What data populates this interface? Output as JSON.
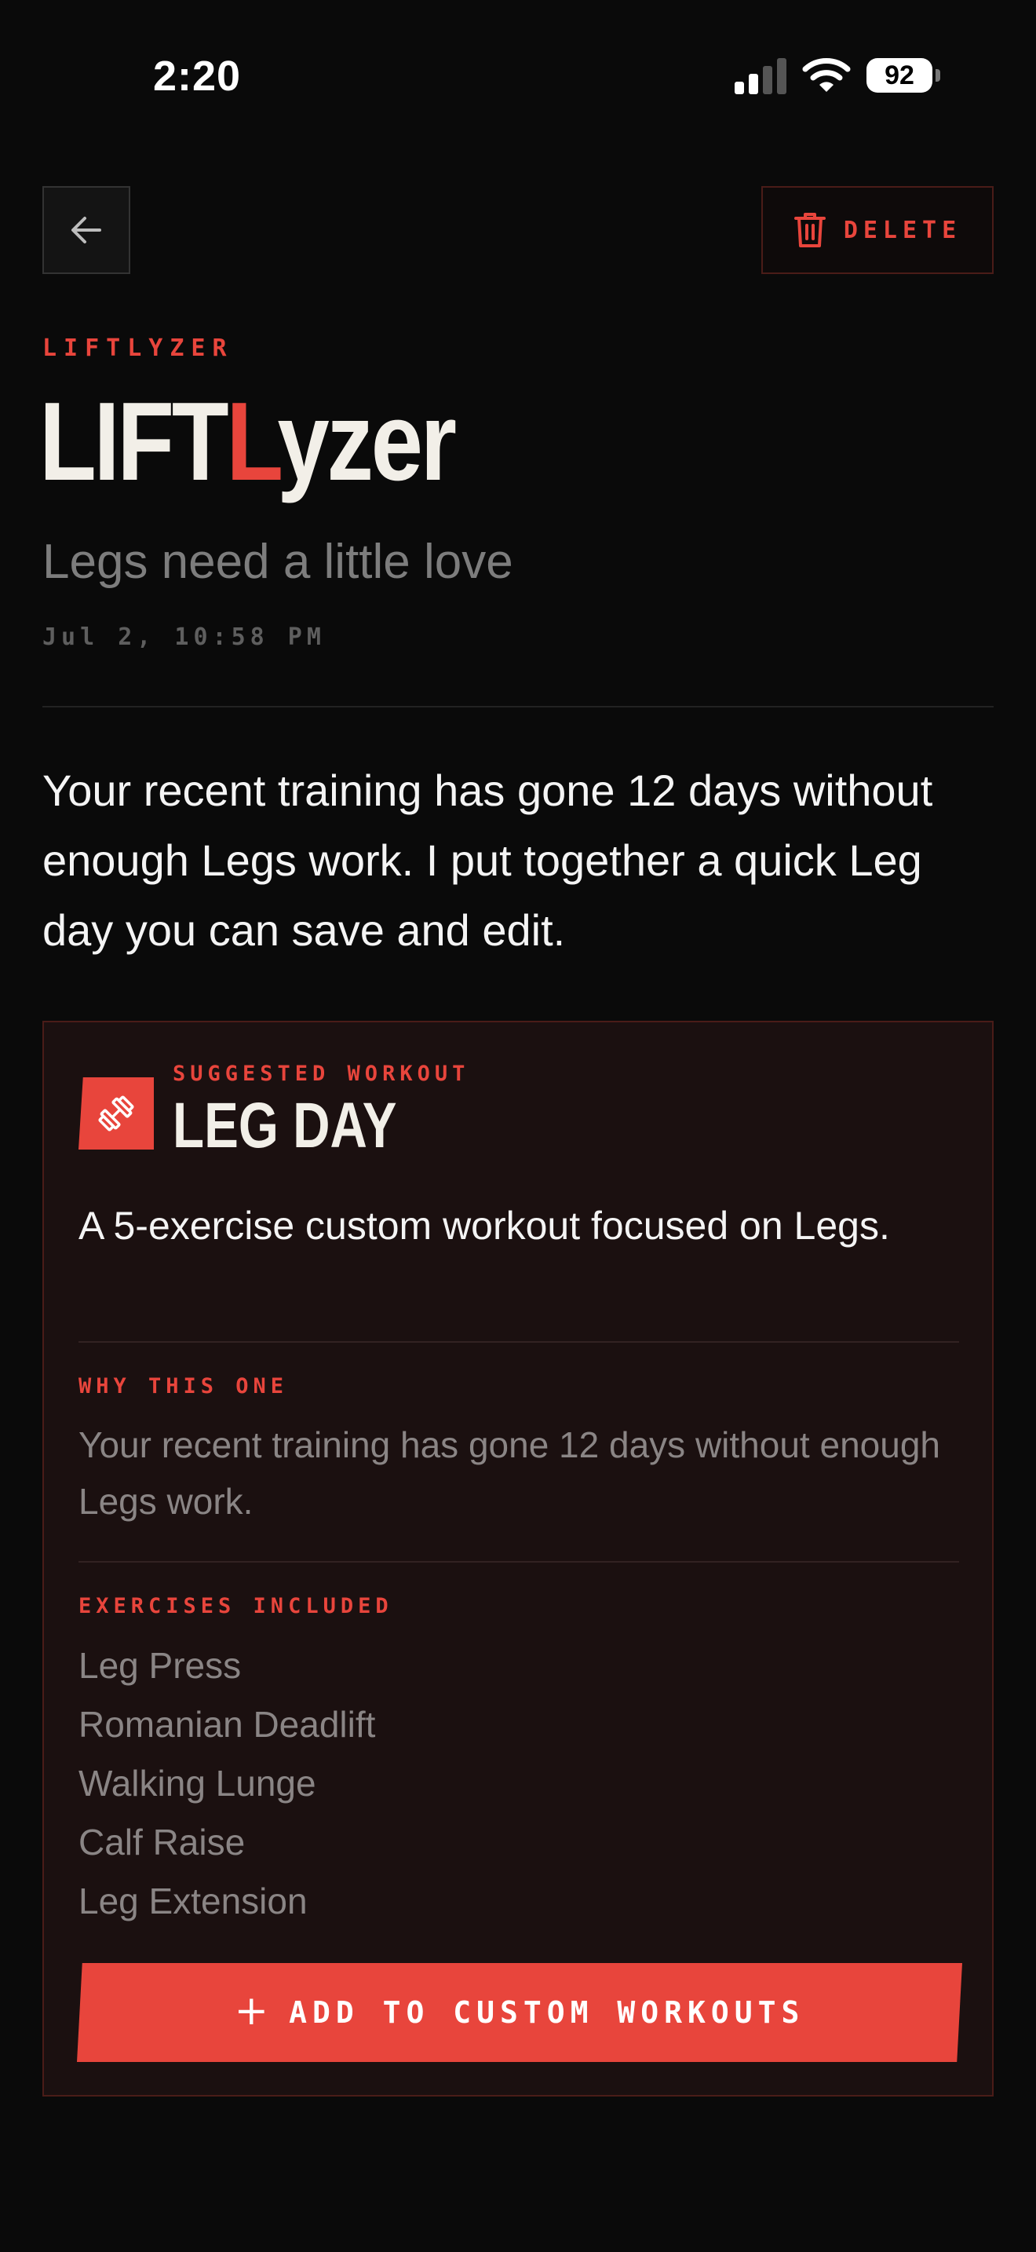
{
  "status_bar": {
    "time": "2:20",
    "battery": "92",
    "icons": [
      "cellular-signal-icon",
      "wifi-icon",
      "battery-icon"
    ]
  },
  "header": {
    "back_icon": "arrow-left-icon",
    "delete_label": "DELETE",
    "delete_icon": "trash-icon"
  },
  "insight": {
    "eyebrow": "LIFTLYZER",
    "brand": {
      "prefix": "LIFT",
      "accent": "L",
      "suffix": "yzer"
    },
    "subtitle": "Legs need a little love",
    "timestamp": "Jul 2, 10:58 PM",
    "message": "Your recent training has gone 12 days without enough Legs work. I put together a quick Leg day you can save and edit."
  },
  "card": {
    "eyebrow": "SUGGESTED WORKOUT",
    "title": "LEG DAY",
    "icon": "dumbbell-icon",
    "description": "A 5-exercise custom workout focused on Legs.",
    "why_label": "WHY THIS ONE",
    "why_text": "Your recent training has gone 12 days without enough Legs work.",
    "exercises_label": "EXERCISES INCLUDED",
    "exercises": [
      "Leg Press",
      "Romanian Deadlift",
      "Walking Lunge",
      "Calf Raise",
      "Leg Extension"
    ],
    "add_button_label": "ADD TO CUSTOM WORKOUTS",
    "add_button_icon": "plus-icon"
  },
  "colors": {
    "background": "#0a0a0a",
    "accent": "#e8453c",
    "card_background": "#1b1010",
    "card_border": "#4a1c18",
    "muted_text": "#8a8585"
  }
}
